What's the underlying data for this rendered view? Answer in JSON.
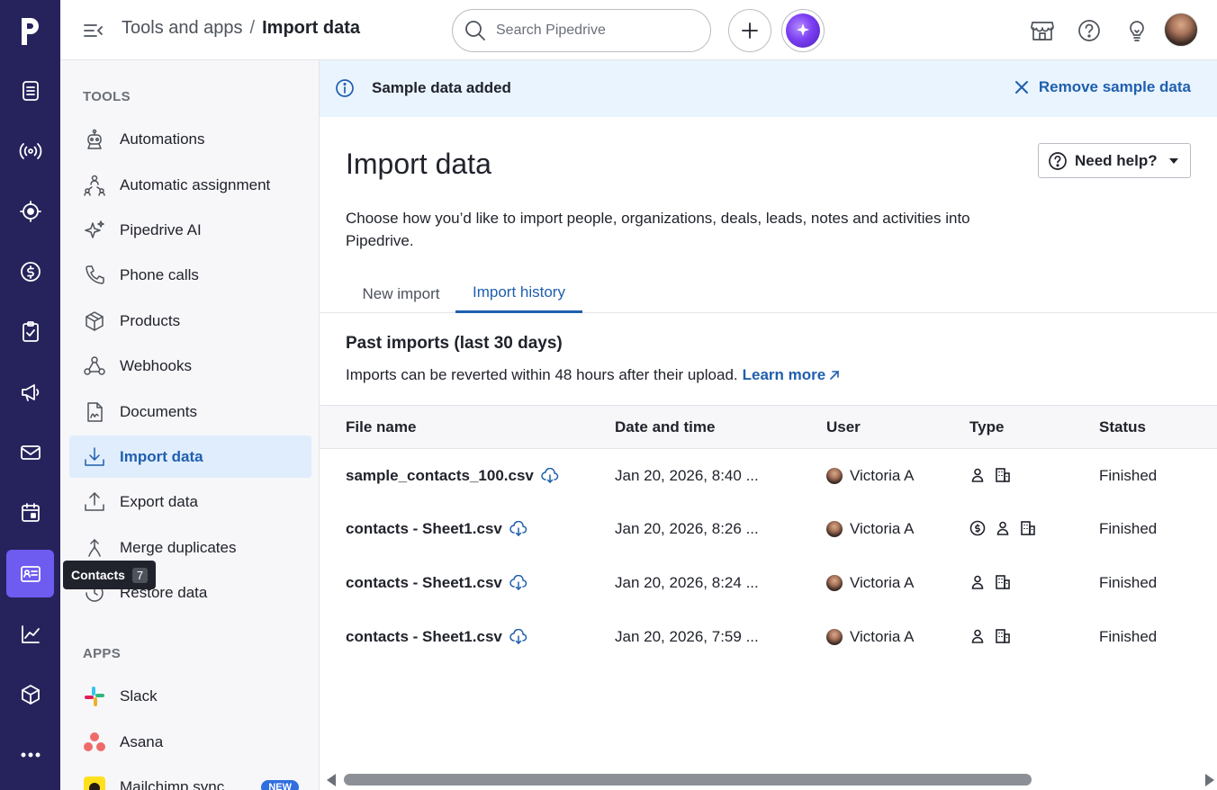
{
  "brand": {
    "logo_letter": "p",
    "rail_color": "#26235c",
    "accent": "#1f5fae"
  },
  "topbar": {
    "breadcrumb_parent": "Tools and apps",
    "breadcrumb_sep": "/",
    "breadcrumb_current": "Import data",
    "search_placeholder": "Search Pipedrive"
  },
  "rail": {
    "items": [
      "leads-icon",
      "broadcast-icon",
      "target-icon",
      "dollar-icon",
      "tasks-icon",
      "megaphone-icon",
      "mail-icon",
      "calendar-icon",
      "contacts-icon",
      "chart-icon",
      "box-icon",
      "more-icon"
    ],
    "active": "contacts-icon"
  },
  "tooltip": {
    "label": "Contacts",
    "shortcut": "7"
  },
  "sidebar": {
    "tools_title": "TOOLS",
    "tools": [
      {
        "label": "Automations",
        "icon": "robot-icon"
      },
      {
        "label": "Automatic assignment",
        "icon": "assignment-icon"
      },
      {
        "label": "Pipedrive AI",
        "icon": "sparkle-icon"
      },
      {
        "label": "Phone calls",
        "icon": "phone-icon"
      },
      {
        "label": "Products",
        "icon": "product-icon"
      },
      {
        "label": "Webhooks",
        "icon": "webhook-icon"
      },
      {
        "label": "Documents",
        "icon": "document-icon"
      },
      {
        "label": "Import data",
        "icon": "import-icon",
        "active": true
      },
      {
        "label": "Export data",
        "icon": "export-icon"
      },
      {
        "label": "Merge duplicates",
        "icon": "merge-icon"
      },
      {
        "label": "Restore data",
        "icon": "restore-icon"
      }
    ],
    "apps_title": "APPS",
    "apps": [
      {
        "label": "Slack",
        "icon": "slack-icon"
      },
      {
        "label": "Asana",
        "icon": "asana-icon"
      },
      {
        "label": "Mailchimp sync",
        "icon": "mailchimp-icon",
        "badge": "NEW"
      }
    ]
  },
  "banner": {
    "text": "Sample data added",
    "action": "Remove sample data",
    "bg": "#eaf4fe"
  },
  "main": {
    "title": "Import data",
    "help_button": "Need help?",
    "intro": "Choose how you’d like to import people, organizations, deals, leads, notes and activities into Pipedrive.",
    "tabs": [
      {
        "label": "New import",
        "active": false
      },
      {
        "label": "Import history",
        "active": true
      }
    ],
    "past_title": "Past imports (last 30 days)",
    "past_desc": "Imports can be reverted within 48 hours after their upload.",
    "learn_more": "Learn more"
  },
  "table": {
    "headers": {
      "file": "File name",
      "date": "Date and time",
      "user": "User",
      "type": "Type",
      "status": "Status"
    },
    "rows": [
      {
        "file": "sample_contacts_100.csv",
        "date": "Jan 20, 2026, 8:40 ...",
        "user": "Victoria A",
        "types": [
          "person-icon",
          "organization-icon"
        ],
        "status": "Finished"
      },
      {
        "file": "contacts - Sheet1.csv",
        "date": "Jan 20, 2026, 8:26 ...",
        "user": "Victoria A",
        "types": [
          "deal-icon",
          "person-icon",
          "organization-icon"
        ],
        "status": "Finished"
      },
      {
        "file": "contacts - Sheet1.csv",
        "date": "Jan 20, 2026, 8:24 ...",
        "user": "Victoria A",
        "types": [
          "person-icon",
          "organization-icon"
        ],
        "status": "Finished"
      },
      {
        "file": "contacts - Sheet1.csv",
        "date": "Jan 20, 2026, 7:59 ...",
        "user": "Victoria A",
        "types": [
          "person-icon",
          "organization-icon"
        ],
        "status": "Finished"
      }
    ]
  }
}
